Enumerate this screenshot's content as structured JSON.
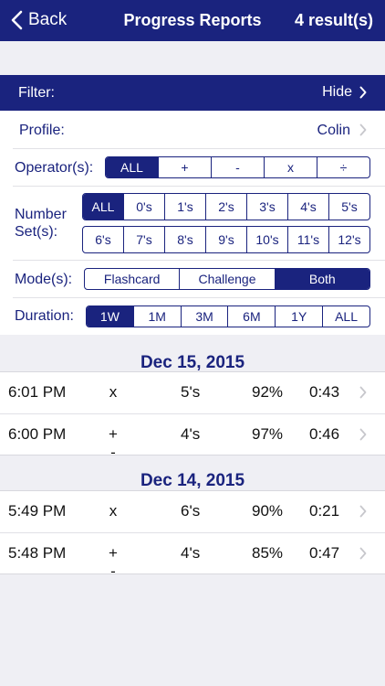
{
  "nav": {
    "back_label": "Back",
    "title": "Progress Reports",
    "result_count": "4 result(s)"
  },
  "filter": {
    "label": "Filter:",
    "action_label": "Hide"
  },
  "profile": {
    "label": "Profile:",
    "value": "Colin"
  },
  "operators": {
    "label": "Operator(s):",
    "options": [
      "ALL",
      "+",
      "-",
      "x",
      "÷"
    ],
    "selected": "ALL"
  },
  "number_sets": {
    "label_line1": "Number",
    "label_line2": "Set(s):",
    "row1": [
      "ALL",
      "0's",
      "1's",
      "2's",
      "3's",
      "4's",
      "5's"
    ],
    "row2": [
      "6's",
      "7's",
      "8's",
      "9's",
      "10's",
      "11's",
      "12's"
    ],
    "selected": "ALL"
  },
  "modes": {
    "label": "Mode(s):",
    "options": [
      "Flashcard",
      "Challenge",
      "Both"
    ],
    "selected": "Both"
  },
  "duration": {
    "label": "Duration:",
    "options": [
      "1W",
      "1M",
      "3M",
      "6M",
      "1Y",
      "ALL"
    ],
    "selected": "1W"
  },
  "sections": [
    {
      "date": "Dec 15, 2015",
      "reports": [
        {
          "time": "6:01 PM",
          "operator": "x",
          "set": "5's",
          "score": "92%",
          "duration": "0:43"
        },
        {
          "time": "6:00 PM",
          "operator": "+ -",
          "set": "4's",
          "score": "97%",
          "duration": "0:46"
        }
      ]
    },
    {
      "date": "Dec 14, 2015",
      "reports": [
        {
          "time": "5:49 PM",
          "operator": "x",
          "set": "6's",
          "score": "90%",
          "duration": "0:21"
        },
        {
          "time": "5:48 PM",
          "operator": "+ -",
          "set": "4's",
          "score": "85%",
          "duration": "0:47"
        }
      ]
    }
  ],
  "colors": {
    "primary": "#1a237e",
    "background": "#efeff4",
    "chevron": "#c7c7cc"
  }
}
